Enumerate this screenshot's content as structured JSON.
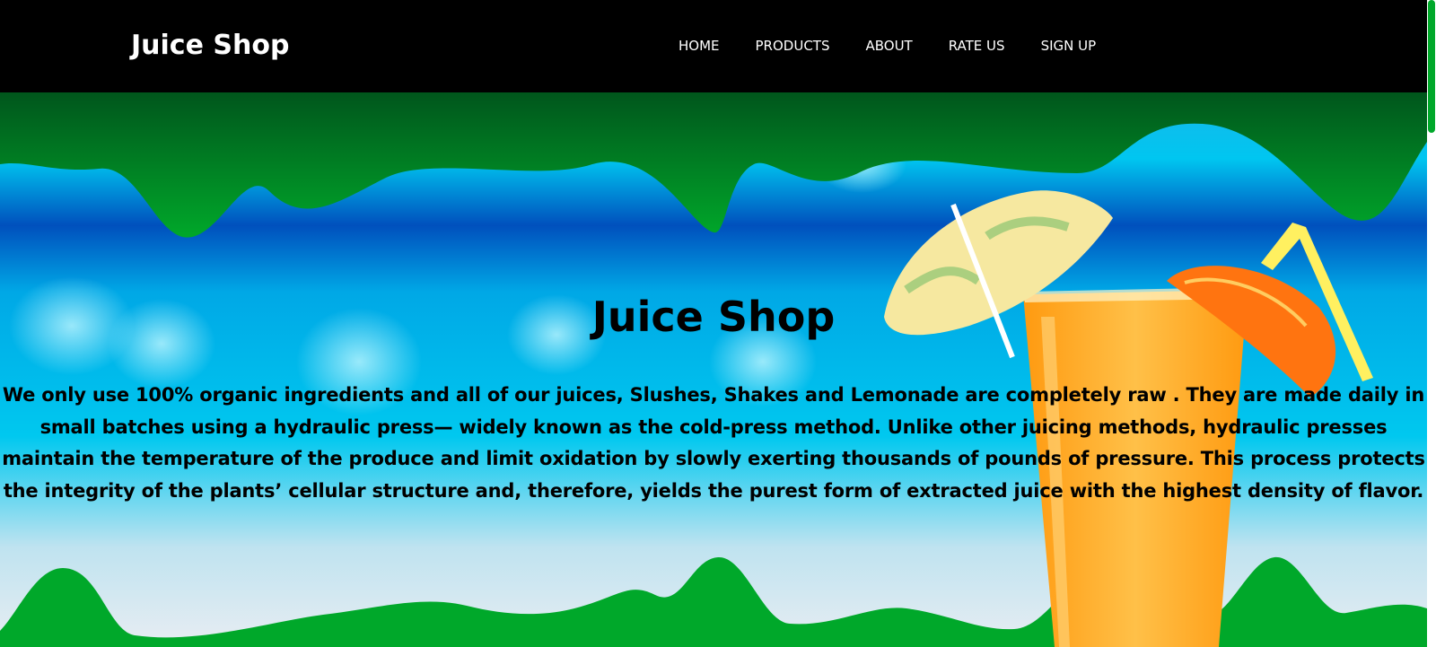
{
  "brand": {
    "name": "Juice Shop"
  },
  "nav": {
    "items": [
      "HOME",
      "PRODUCTS",
      "ABOUT",
      "RATE US",
      "SIGN UP"
    ]
  },
  "hero": {
    "title": "Juice Shop",
    "text": "We only use 100% organic ingredients and all of our juices, Slushes, Shakes and Lemonade are completely raw . They are made daily in small batches using a hydraulic press— widely known as the cold-press method. Unlike other juicing methods, hydraulic presses maintain the temperature of the produce and limit oxidation by slowly exerting thousands of pounds of pressure. This process protects the integrity of the plants’ cellular structure and, therefore, yields the purest form of extracted juice with the highest density of flavor."
  },
  "colors": {
    "navbar": "#000000",
    "wave_green": "#00a82a",
    "wave_green_dark": "#00601e",
    "sky_blue": "#00c8ef",
    "deep_blue": "#0060c8",
    "juice_orange": "#ffa020"
  },
  "icons": {
    "decor": [
      "cocktail-umbrella-icon",
      "orange-slice-icon",
      "straw-icon",
      "juice-glass-icon"
    ]
  }
}
